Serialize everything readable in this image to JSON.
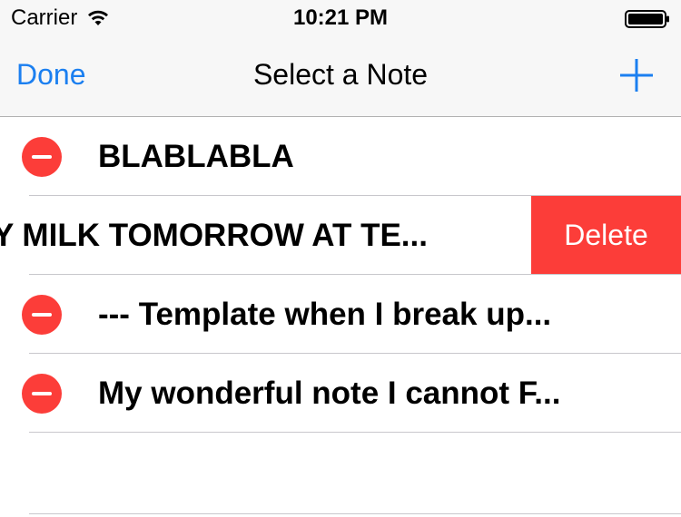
{
  "status_bar": {
    "carrier": "Carrier",
    "time": "10:21 PM"
  },
  "nav_bar": {
    "done_label": "Done",
    "title": "Select a Note",
    "add_icon": "plus-icon",
    "tint_color": "#1b7ff0"
  },
  "notes": [
    {
      "title": "BLABLABLA"
    },
    {
      "title": "Y MILK TOMORROW AT TE...",
      "swiped": true,
      "delete_label": "Delete"
    },
    {
      "title": "--- Template when I break up..."
    },
    {
      "title": "My wonderful note I cannot F..."
    }
  ],
  "colors": {
    "delete_red": "#fc3d39",
    "separator": "#c8c7cc"
  }
}
